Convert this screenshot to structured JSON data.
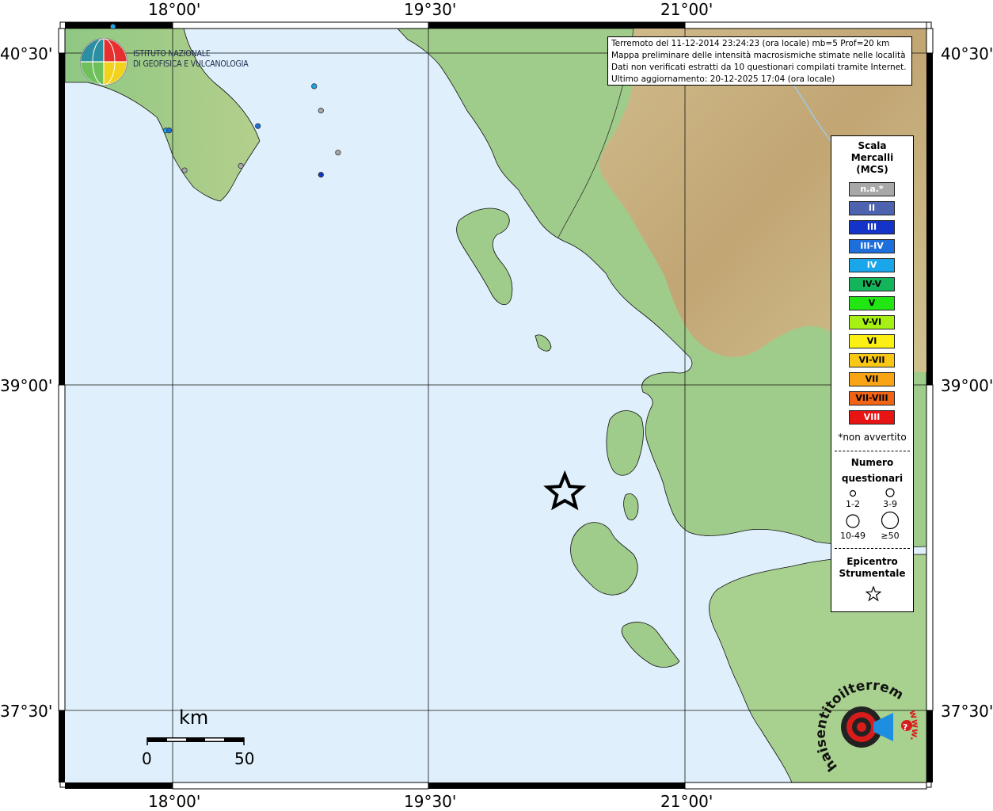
{
  "map": {
    "coords": {
      "top": [
        "18°00'",
        "19°30'",
        "21°00'"
      ],
      "bottom": [
        "18°00'",
        "19°30'",
        "21°00'"
      ],
      "left": [
        "40°30'",
        "39°00'",
        "37°30'"
      ],
      "right": [
        "40°30'",
        "39°00'",
        "37°30'"
      ]
    },
    "colors": {
      "sea": "#dfeffb",
      "land_low": "#8fc684",
      "land_mid": "#cfd9a0",
      "land_high": "#d6b48a",
      "frame": "#000000"
    }
  },
  "info": {
    "line1": "Terremoto del 11-12-2014 23:24:23 (ora locale) mb=5 Prof=20 km",
    "line2": "Mappa preliminare delle intensità macrosismiche stimate nelle località",
    "line3": "Dati non verificati estratti da 10 questionari compilati tramite Internet.",
    "line4": "Ultimo aggiornamento: 20-12-2025 17:04 (ora locale)"
  },
  "logo": {
    "ingv_line1": "ISTITUTO NAZIONALE",
    "ingv_line2": "DI GEOFISICA E VULCANOLOGIA",
    "hsit_text": "haisentitoilterremoto.it",
    "hsit_www": "www.",
    "hsit_q": "?"
  },
  "legend": {
    "title1": "Scala",
    "title2": "Mercalli",
    "title3": "(MCS)",
    "classes": [
      {
        "label": "n.a.*",
        "color": "#a8a8a8",
        "text": "#ffffff"
      },
      {
        "label": "II",
        "color": "#4e63b0",
        "text": "#ffffff"
      },
      {
        "label": "III",
        "color": "#1433c8",
        "text": "#ffffff"
      },
      {
        "label": "III-IV",
        "color": "#1e6fdc",
        "text": "#ffffff"
      },
      {
        "label": "IV",
        "color": "#19a6ea",
        "text": "#ffffff"
      },
      {
        "label": "IV-V",
        "color": "#14b45a",
        "text": "#000000"
      },
      {
        "label": "V",
        "color": "#22e614",
        "text": "#000000"
      },
      {
        "label": "V-VI",
        "color": "#a6f014",
        "text": "#000000"
      },
      {
        "label": "VI",
        "color": "#faf014",
        "text": "#000000"
      },
      {
        "label": "VI-VII",
        "color": "#f8c814",
        "text": "#000000"
      },
      {
        "label": "VII",
        "color": "#f8a414",
        "text": "#000000"
      },
      {
        "label": "VII-VIII",
        "color": "#f06414",
        "text": "#000000"
      },
      {
        "label": "VIII",
        "color": "#e81414",
        "text": "#ffffff"
      }
    ],
    "not_felt": "*non avvertito",
    "count_title1": "Numero",
    "count_title2": "questionari",
    "sizes": [
      "1-2",
      "3-9",
      "10-49",
      "≥50"
    ],
    "epi_title1": "Epicentro",
    "epi_title2": "Strumentale"
  },
  "scalebar": {
    "unit": "km",
    "min": "0",
    "max": "50"
  },
  "observations": [
    {
      "mcs": "IV",
      "lon": 18.83,
      "lat": 40.35,
      "size": "1-2"
    },
    {
      "mcs": "n.a.*",
      "lon": 18.87,
      "lat": 40.24,
      "size": "1-2"
    },
    {
      "mcs": "IV",
      "lon": 17.96,
      "lat": 40.15,
      "size": "1-2"
    },
    {
      "mcs": "III-IV",
      "lon": 17.98,
      "lat": 40.15,
      "size": "1-2"
    },
    {
      "mcs": "III-IV",
      "lon": 18.5,
      "lat": 40.17,
      "size": "1-2"
    },
    {
      "mcs": "n.a.*",
      "lon": 18.07,
      "lat": 39.97,
      "size": "1-2"
    },
    {
      "mcs": "n.a.*",
      "lon": 18.4,
      "lat": 39.99,
      "size": "1-2"
    },
    {
      "mcs": "III",
      "lon": 18.87,
      "lat": 39.95,
      "size": "1-2"
    },
    {
      "mcs": "n.a.*",
      "lon": 18.97,
      "lat": 40.05,
      "size": "1-2"
    },
    {
      "mcs": "IV",
      "lon": 17.65,
      "lat": 40.62,
      "size": "1-2"
    }
  ],
  "epicenter": {
    "lon": 20.3,
    "lat": 38.52
  }
}
